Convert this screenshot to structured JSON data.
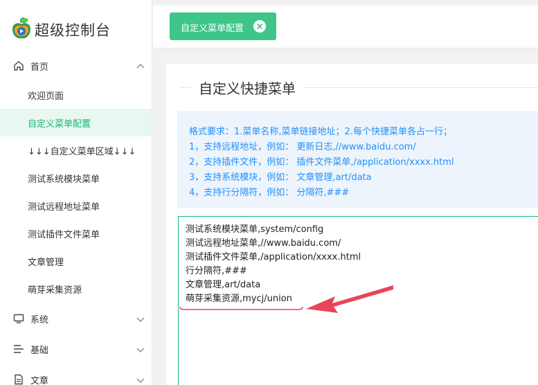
{
  "app": {
    "title": "超级控制台"
  },
  "sidebar": {
    "groups": [
      {
        "label": "首页",
        "icon": "home-icon",
        "expanded": true
      },
      {
        "label": "系统",
        "icon": "monitor-icon",
        "expanded": false
      },
      {
        "label": "基础",
        "icon": "list-icon",
        "expanded": false
      },
      {
        "label": "文章",
        "icon": "document-icon",
        "expanded": false
      }
    ],
    "items": [
      {
        "label": "欢迎页面"
      },
      {
        "label": "自定义菜单配置",
        "active": true
      },
      {
        "label": "↓↓↓自定义菜单区域↓↓↓"
      },
      {
        "label": "测试系统模块菜单"
      },
      {
        "label": "测试远程地址菜单"
      },
      {
        "label": "测试插件文件菜单"
      },
      {
        "label": "文章管理"
      },
      {
        "label": "萌芽采集资源"
      }
    ]
  },
  "tabs": [
    {
      "label": "自定义菜单配置",
      "active": true
    }
  ],
  "main": {
    "title": "自定义快捷菜单",
    "help_lines": [
      "格式要求：1.菜单名称,菜单链接地址；2.每个快捷菜单各占一行；",
      "1，支持远程地址，例如：  更新日志,//www.baidu.com/",
      "2，支持插件文件，例如：  插件文件菜单,/application/xxxx.html",
      "3，支持系统模块，例如：  文章管理,art/data",
      "4，支持行分隔符，例如：  分隔符,###"
    ],
    "textarea_lines": [
      "测试系统模块菜单,system/config",
      "测试远程地址菜单,//www.baidu.com/",
      "测试插件文件菜单,/application/xxxx.html",
      "行分隔符,###",
      "文章管理,art/data",
      "萌芽采集资源,mycj/union"
    ]
  },
  "colors": {
    "accent": "#16b777",
    "tab_bg": "#3ec58a",
    "help_text": "#1e90ff",
    "annotation_red": "#e8455a"
  }
}
